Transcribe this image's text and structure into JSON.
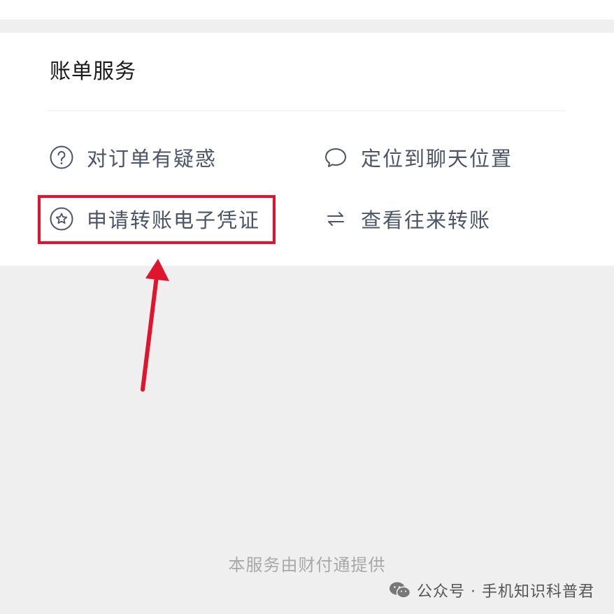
{
  "bill_services": {
    "title": "账单服务",
    "items": [
      {
        "label": "对订单有疑惑",
        "icon": "question-circle-icon"
      },
      {
        "label": "定位到聊天位置",
        "icon": "chat-bubble-icon"
      },
      {
        "label": "申请转账电子凭证",
        "icon": "star-circle-icon"
      },
      {
        "label": "查看往来转账",
        "icon": "transfer-arrows-icon"
      }
    ]
  },
  "footer": {
    "provider_text": "本服务由财付通提供"
  },
  "watermark": {
    "text": "公众号 · 手机知识科普君",
    "icon": "wechat-logo-icon"
  },
  "annotation": {
    "highlight_color": "#e0142d"
  }
}
